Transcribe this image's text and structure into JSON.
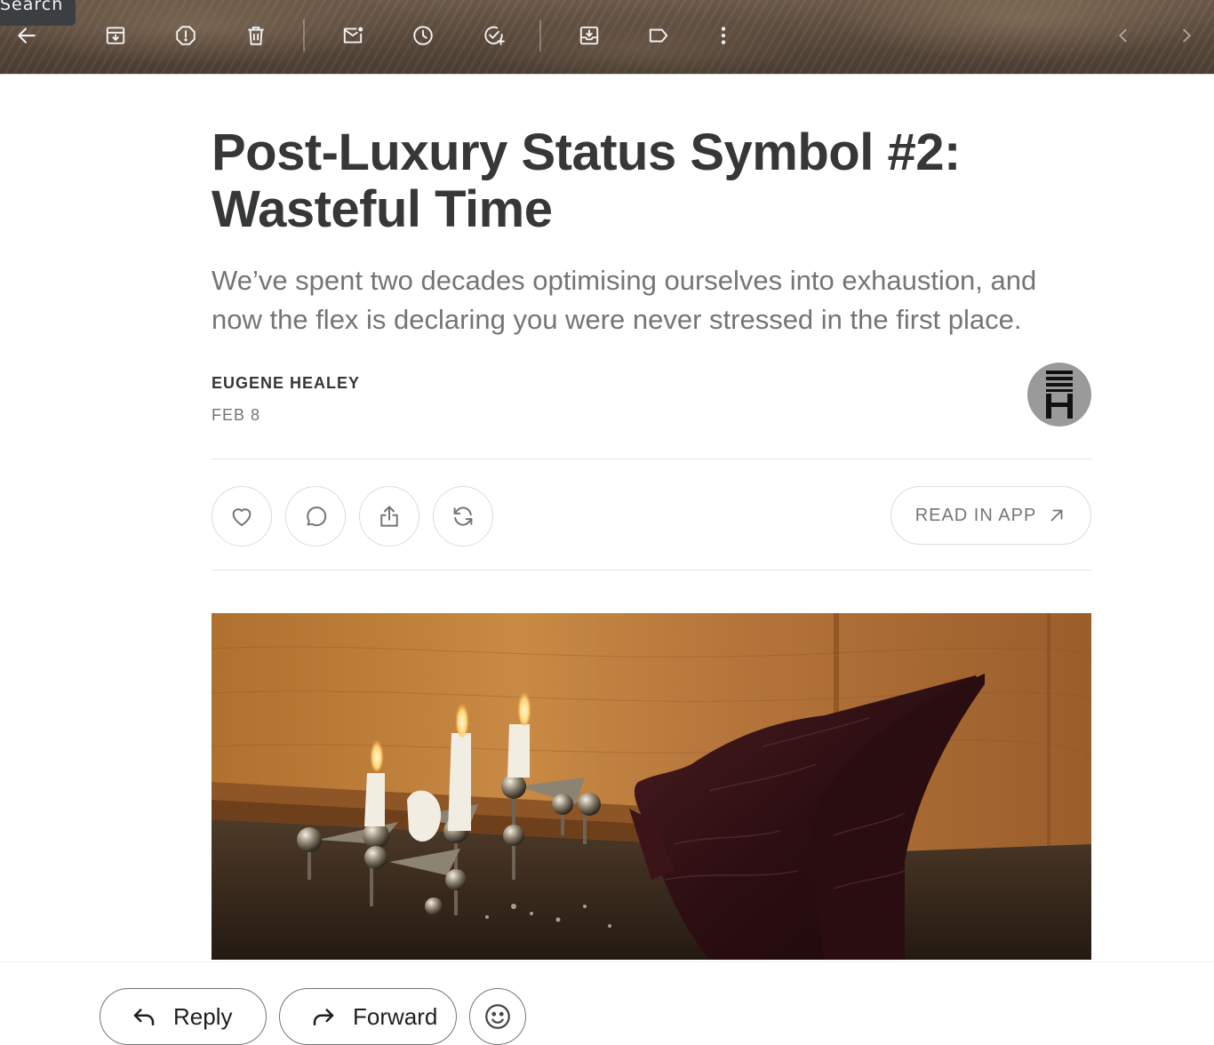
{
  "toolbar": {
    "search_tooltip": "Search",
    "icons": [
      "back-arrow-icon",
      "archive-icon",
      "report-spam-icon",
      "delete-icon",
      "mark-unread-icon",
      "snooze-icon",
      "add-task-icon",
      "move-to-icon",
      "label-icon",
      "more-vert-icon",
      "chevron-left-icon",
      "chevron-right-icon"
    ]
  },
  "article": {
    "title": "Post-Luxury Status Symbol #2: Wasteful Time",
    "subtitle": "We’ve spent two decades optimising ourselves into exhaustion, and now the flex is declaring you were never stressed in the first place.",
    "author": "EUGENE HEALEY",
    "date": "FEB 8"
  },
  "actions": {
    "icons": [
      "heart-icon",
      "comment-icon",
      "share-icon",
      "restack-icon"
    ],
    "read_in_app": "READ IN APP"
  },
  "reply_bar": {
    "reply_label": "Reply",
    "forward_label": "Forward"
  },
  "colors": {
    "title": "#363737",
    "subtitle": "#757575",
    "toolbar_bg": "#5a4a3c"
  }
}
